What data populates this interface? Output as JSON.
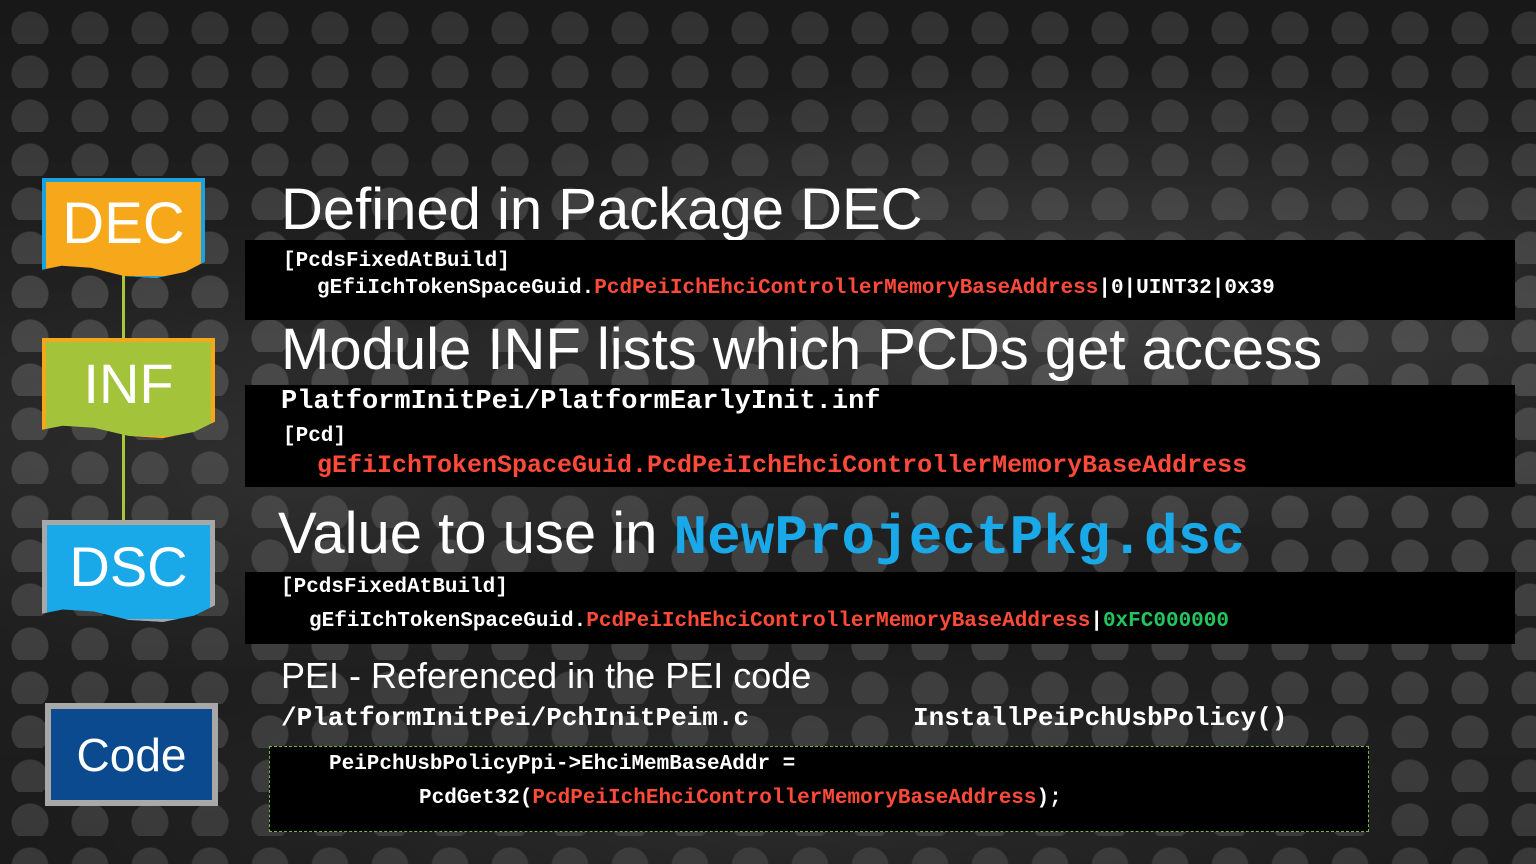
{
  "badges": {
    "dec": "DEC",
    "inf": "INF",
    "dsc": "DSC",
    "code": "Code"
  },
  "section_dec": {
    "heading": "Defined in Package DEC",
    "line1": "[PcdsFixedAtBuild]",
    "line2_prefix": "gEfiIchTokenSpaceGuid.",
    "line2_pcd": "PcdPeiIchEhciControllerMemoryBaseAddress",
    "line2_suffix": "|0|UINT32|0x39"
  },
  "section_inf": {
    "heading": "Module INF lists which PCDs get access",
    "line1": "PlatformInitPei/PlatformEarlyInit.inf",
    "line2": "[Pcd]",
    "line3": "gEfiIchTokenSpaceGuid.PcdPeiIchEhciControllerMemoryBaseAddress"
  },
  "section_dsc": {
    "heading_prefix": "Value to use in ",
    "heading_file": "NewProjectPkg.dsc",
    "line1": "[PcdsFixedAtBuild]",
    "line2_prefix": "gEfiIchTokenSpaceGuid.",
    "line2_pcd": "PcdPeiIchEhciControllerMemoryBaseAddress",
    "line2_sep": "|",
    "line2_value": "0xFC000000"
  },
  "section_code": {
    "heading": "PEI - Referenced in the PEI code",
    "path": "/PlatformInitPei/PchInitPeim.c",
    "function": "InstallPeiPchUsbPolicy()",
    "line1": "PeiPchUsbPolicyPpi->EhciMemBaseAddr =",
    "line2_prefix": "PcdGet32(",
    "line2_pcd": "PcdPeiIchEhciControllerMemoryBaseAddress",
    "line2_suffix": ");"
  },
  "colors": {
    "dec_badge": "#f6a81a",
    "inf_badge": "#a3c33a",
    "dsc_badge": "#1aa9e8",
    "code_badge": "#0b4a8e",
    "pcd_red": "#ff4a3a",
    "value_green": "#22c55e"
  }
}
